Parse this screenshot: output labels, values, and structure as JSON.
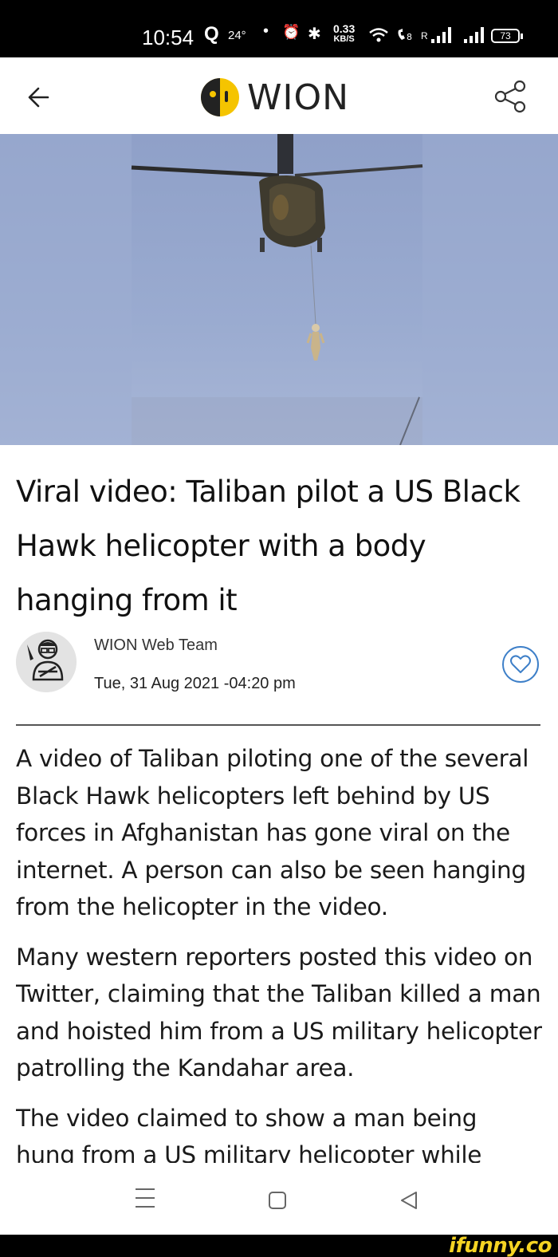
{
  "status_bar": {
    "time": "10:54",
    "search_glyph": "Q",
    "temperature": "24°",
    "dot": "•",
    "alarm_glyph": "⏰",
    "bluetooth_glyph": "✱",
    "net_speed_value": "0.33",
    "net_speed_unit": "KB/S",
    "roaming_label": "R",
    "battery": "73",
    "icons": [
      "search-icon",
      "alarm-icon",
      "bluetooth-icon",
      "wifi-icon",
      "volte-icon",
      "signal-icon",
      "battery-icon"
    ]
  },
  "header": {
    "logo_text": "WION",
    "back_icon": "arrow-left-icon",
    "share_icon": "share-icon",
    "brand_colors": {
      "yellow": "#f5c400",
      "dark": "#222222"
    }
  },
  "article": {
    "headline": "Viral video: Taliban pilot a US Black Hawk helicopter with a body hanging from it",
    "author": "WION Web Team",
    "date": "Tue, 31 Aug 2021 -04:20 pm",
    "like_icon": "heart-icon",
    "paragraphs": [
      "A video of Taliban piloting one of the several Black Hawk helicopters left behind by US forces in Afghanistan has gone viral on the internet. A person can also be seen hanging from the helicopter in the video.",
      "Many western reporters posted this video on Twitter, claiming that the Taliban killed a man and hoisted him from a US military helicopter patrolling the Kandahar area.",
      "The video claimed to show a man being hung from a US military helicopter while"
    ]
  },
  "nav_bar": {
    "icons": [
      "recent-apps-icon",
      "home-icon",
      "back-triangle-icon"
    ]
  },
  "watermark": {
    "text": "ifunny.co",
    "color": "#f5d323"
  }
}
